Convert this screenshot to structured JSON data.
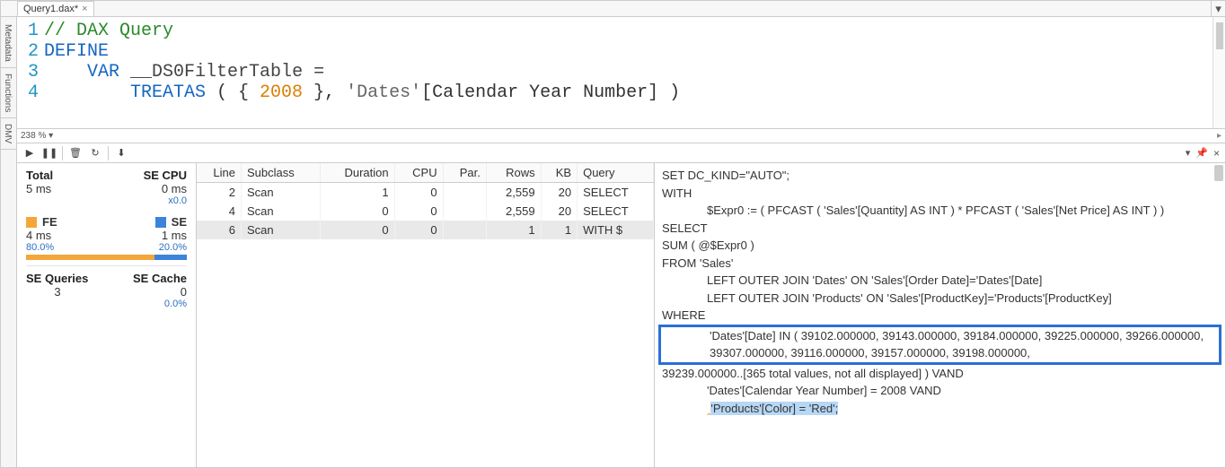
{
  "tab": {
    "title": "Query1.dax*"
  },
  "side_tabs": [
    "Metadata",
    "Functions",
    "DMV"
  ],
  "editor": {
    "lines": [
      "1",
      "2",
      "3",
      "4"
    ],
    "l1_comment": "// DAX Query",
    "l2_kw": "DEFINE",
    "l3_kw": "VAR",
    "l3_id": " __DS0FilterTable ",
    "l3_eq": "=",
    "l4_func": "TREATAS",
    "l4_open": " ( { ",
    "l4_num": "2008",
    "l4_mid": " }, ",
    "l4_tbl": "'Dates'",
    "l4_col": "[Calendar Year Number] )"
  },
  "zoom": "238 %",
  "stats": {
    "total_lbl": "Total",
    "total_val": "5 ms",
    "secpu_lbl": "SE CPU",
    "secpu_val": "0 ms",
    "secpu_sub": "x0.0",
    "fe_lbl": "FE",
    "fe_val": "4 ms",
    "fe_pct": "80.0%",
    "se_lbl": "SE",
    "se_val": "1 ms",
    "se_pct": "20.0%",
    "seq_lbl": "SE Queries",
    "seq_val": "3",
    "sec_lbl": "SE Cache",
    "sec_val": "0",
    "sec_sub": "0.0%"
  },
  "cols": {
    "line": "Line",
    "subclass": "Subclass",
    "duration": "Duration",
    "cpu": "CPU",
    "par": "Par.",
    "rows": "Rows",
    "kb": "KB",
    "query": "Query"
  },
  "rows": [
    {
      "line": "2",
      "subclass": "Scan",
      "duration": "1",
      "cpu": "0",
      "par": "",
      "rows": "2,559",
      "kb": "20",
      "query": "SELECT"
    },
    {
      "line": "4",
      "subclass": "Scan",
      "duration": "0",
      "cpu": "0",
      "par": "",
      "rows": "2,559",
      "kb": "20",
      "query": "SELECT"
    },
    {
      "line": "6",
      "subclass": "Scan",
      "duration": "0",
      "cpu": "0",
      "par": "",
      "rows": "1",
      "kb": "1",
      "query": "WITH $"
    }
  ],
  "detail": {
    "l1": "SET DC_KIND=\"AUTO\";",
    "l2": "WITH",
    "l3": "$Expr0 := ( PFCAST ( 'Sales'[Quantity] AS  INT ) * PFCAST ( 'Sales'[Net Price] AS INT )  )",
    "l4": "SELECT",
    "l5": "SUM ( @$Expr0 )",
    "l6": "FROM 'Sales'",
    "l7": "LEFT OUTER JOIN 'Dates' ON 'Sales'[Order Date]='Dates'[Date]",
    "l8": "LEFT OUTER JOIN 'Products' ON 'Sales'[ProductKey]='Products'[ProductKey]",
    "l9": "WHERE",
    "l10": "'Dates'[Date] IN ( 39102.000000, 39143.000000, 39184.000000, 39225.000000, 39266.000000, 39307.000000, 39116.000000, 39157.000000, 39198.000000,",
    "l11": "39239.000000..[365 total values, not all displayed] ) VAND",
    "l12": "'Dates'[Calendar Year Number] = 2008 VAND",
    "l13": "'Products'[Color] = 'Red';"
  }
}
